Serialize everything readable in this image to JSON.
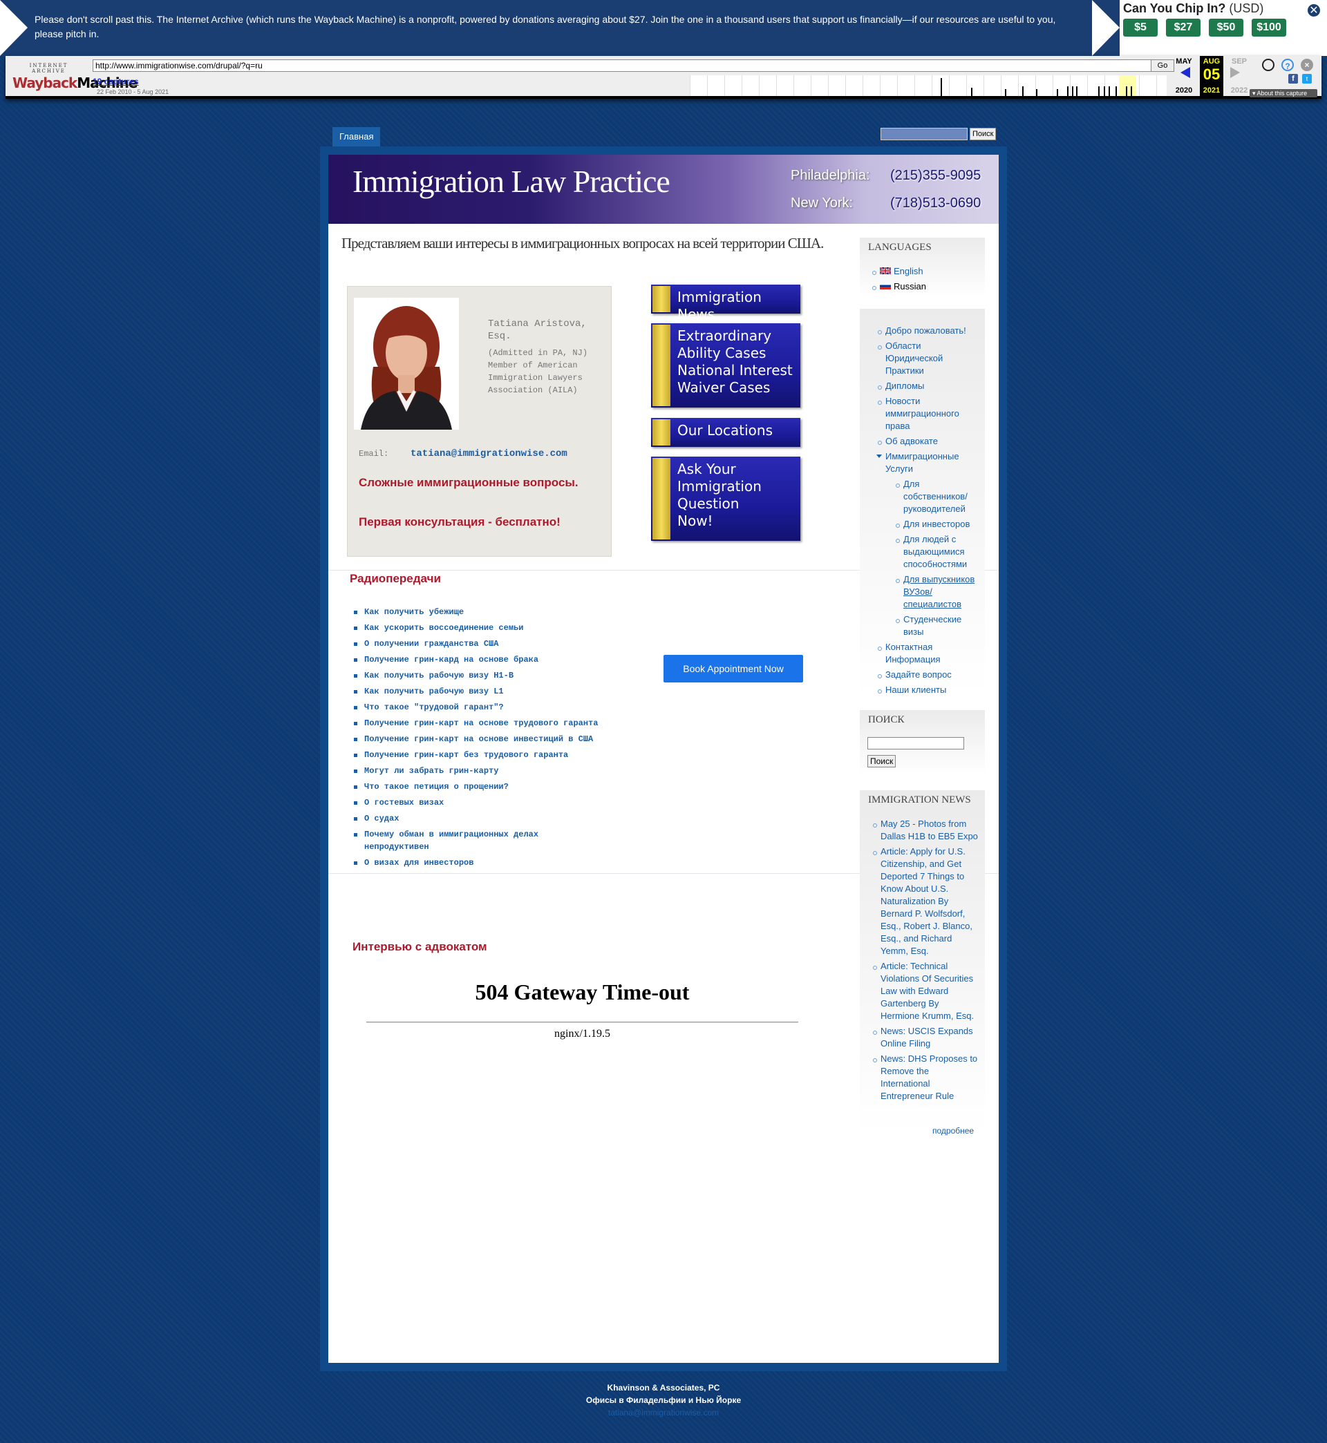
{
  "donation": {
    "message": "Please don't scroll past this. The Internet Archive (which runs the Wayback Machine) is a nonprofit, powered by donations averaging about $27. Join the one in a thousand users that support us financially—if our resources are useful to you, please pitch in.",
    "chip_title": "Can You Chip In?",
    "currency": "(USD)",
    "amounts": [
      "$5",
      "$27",
      "$50",
      "$100"
    ],
    "close": "✕"
  },
  "wayback": {
    "logo_top": "INTERNET ARCHIVE",
    "logo_wayback": "Wayback",
    "logo_machine": "Machine",
    "url": "http://www.immigrationwise.com/drupal/?q=ru",
    "go": "Go",
    "captures": "19 captures",
    "range": "22 Feb 2010 - 5 Aug 2021",
    "prev_month": "MAY",
    "cur_month": "AUG",
    "next_month": "SEP",
    "prev_year": "2020",
    "cur_day": "05",
    "cur_year": "2021",
    "next_year": "2022",
    "about": "About this capture"
  },
  "nav": {
    "home": "Главная",
    "search_btn": "Поиск"
  },
  "header": {
    "title": "Immigration Law Practice",
    "city1": "Philadelphia:",
    "phone1": "(215)355-9095",
    "city2": "New York:",
    "phone2": "(718)513-0690"
  },
  "tagline": "Представляем ваши интересы в иммиграционных вопросах на всей территории США.",
  "profile": {
    "name": "Tatiana Aristova, Esq.",
    "info": "(Admitted in PA, NJ) Member of American Immigration Lawyers Association (AILA)",
    "email_label": "Email:",
    "email": "tatiana@immigrationwise.com",
    "line1": "Сложные иммиграционные вопросы.",
    "line2": "Первая консультация - бесплатно!"
  },
  "promos": [
    "Immigration News",
    "Extraordinary Ability Cases National Interest Waiver Cases",
    "Our Locations",
    "Ask Your Immigration Question Now!"
  ],
  "radio": {
    "title": "Радиопередачи",
    "items": [
      "Как получить убежище",
      "Как ускорить воссоединение семьи",
      "О получении гражданства США",
      "Получение грин-кард на основе брака",
      "Как получить рабочую визу H1-B",
      "Как получить рабочую визу L1",
      "Что такое \"трудовой гарант\"?",
      "Получение грин-карт на основе трудового гаранта",
      "Получение грин-карт на основе инвестиций в США",
      "Получение грин-карт без трудового гаранта",
      "Могут ли забрать грин-карту",
      "Что такое петиция о прощении?",
      "О гостевых визах",
      "О судах",
      "Почему обман в иммиграционных делах непродуктивен",
      "О визах для инвесторов"
    ]
  },
  "book_button": "Book Appointment Now",
  "interview_title": "Интервью с адвокатом",
  "error": {
    "title": "504 Gateway Time-out",
    "server": "nginx/1.19.5"
  },
  "sidebar": {
    "languages_title": "LANGUAGES",
    "languages": [
      "English",
      "Russian"
    ],
    "menu": [
      "Добро пожаловать!",
      "Области Юридической Практики",
      "Дипломы",
      "Новости иммиграционного права",
      "Об адвокате",
      "Иммиграционные Услуги",
      "Для собственников/ руководителей",
      "Для инвесторов",
      "Для людей с выдающимися способностями",
      "Для выпускников ВУЗов/ специалистов",
      "Студенческие визы",
      "Контактная Информация",
      "Задайте вопрос",
      "Наши клиенты"
    ],
    "search_title": "ПОИСК",
    "search_btn": "Поиск",
    "news_title": "IMMIGRATION NEWS",
    "news": [
      "May 25 - Photos from Dallas H1B to EB5 Expo",
      "Article: Apply for U.S. Citizenship, and Get Deported 7 Things to Know About U.S. Naturalization By Bernard P. Wolfsdorf, Esq., Robert J. Blanco, Esq., and Richard Yemm, Esq.",
      "Article: Technical Violations Of Securities Law with Edward Gartenberg By Hermione Krumm, Esq.",
      "News: USCIS Expands Online Filing",
      "News: DHS Proposes to Remove the International Entrepreneur Rule"
    ],
    "more": "подробнее"
  },
  "footer": {
    "company": "Khavinson & Associates, PC",
    "offices": "Офисы в Филадельфии и Нью Йорке",
    "email": "tatiana@immigrationwise.com"
  }
}
